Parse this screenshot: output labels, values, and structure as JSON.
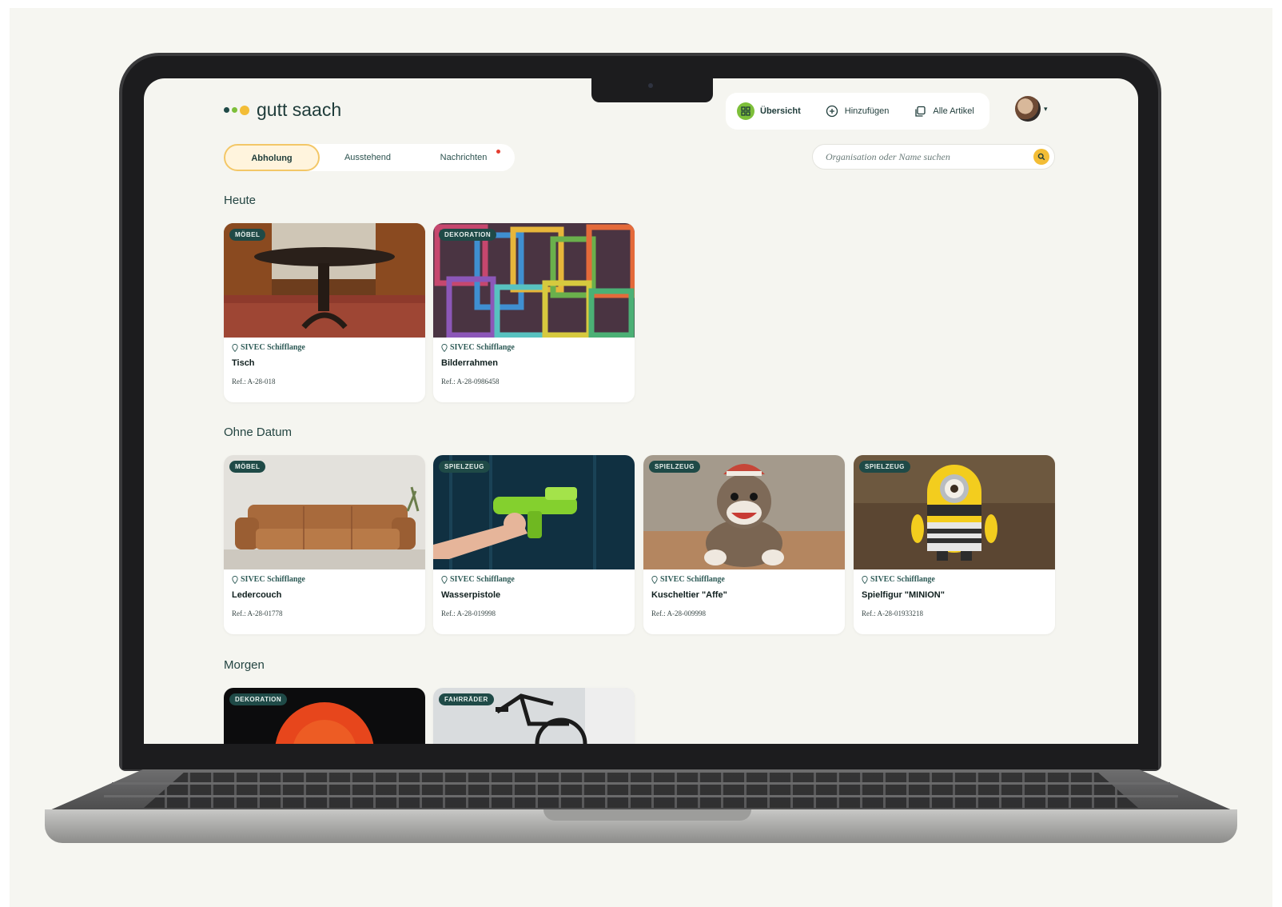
{
  "brand": {
    "name": "gutt saach",
    "colors": {
      "green": "#7dbf3a",
      "teal": "#1f4a47",
      "yellow": "#f3bd36",
      "accent_border": "#f3c767",
      "notification": "#e43d30"
    }
  },
  "topnav": {
    "items": [
      {
        "label": "Übersicht",
        "icon": "grid-icon"
      },
      {
        "label": "Hinzufügen",
        "icon": "plus-circle-icon"
      },
      {
        "label": "Alle Artikel",
        "icon": "stack-icon"
      }
    ],
    "avatar": "user-avatar"
  },
  "tabs": [
    {
      "label": "Abholung",
      "active": true
    },
    {
      "label": "Ausstehend",
      "active": false
    },
    {
      "label": "Nachrichten",
      "active": false,
      "notification": true
    }
  ],
  "search": {
    "placeholder": "Organisation oder Name suchen",
    "value": ""
  },
  "sections": [
    {
      "title": "Heute",
      "items": [
        {
          "badge": "MÖBEL",
          "location": "SIVEC Schifflange",
          "name": "Tisch",
          "ref": "Ref.: A-28-018"
        },
        {
          "badge": "DEKORATION",
          "location": "SIVEC Schifflange",
          "name": "Bilderrahmen",
          "ref": "Ref.: A-28-0986458"
        }
      ]
    },
    {
      "title": "Ohne Datum",
      "items": [
        {
          "badge": "MÖBEL",
          "location": "SIVEC Schifflange",
          "name": "Ledercouch",
          "ref": "Ref.: A-28-01778"
        },
        {
          "badge": "SPIELZEUG",
          "location": "SIVEC Schifflange",
          "name": "Wasserpistole",
          "ref": "Ref.: A-28-019998"
        },
        {
          "badge": "SPIELZEUG",
          "location": "SIVEC Schifflange",
          "name": "Kuscheltier \"Affe\"",
          "ref": "Ref.: A-28-009998"
        },
        {
          "badge": "SPIELZEUG",
          "location": "SIVEC Schifflange",
          "name": "Spielfigur \"MINION\"",
          "ref": "Ref.: A-28-01933218"
        }
      ]
    },
    {
      "title": "Morgen",
      "items": [
        {
          "badge": "DEKORATION"
        },
        {
          "badge": "FAHRRÄDER"
        }
      ]
    }
  ]
}
